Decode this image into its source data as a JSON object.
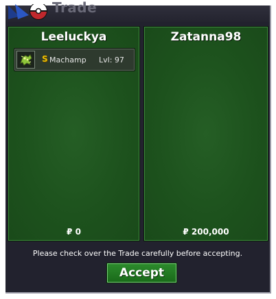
{
  "window": {
    "title": "Trade"
  },
  "left_panel": {
    "player_name": "Leeluckya",
    "items": [
      {
        "shiny_mark": "S",
        "pokemon": "Machamp",
        "level": "Lvl: 97",
        "icon": "machamp-sprite-icon"
      }
    ],
    "money": "₽ 0"
  },
  "right_panel": {
    "player_name": "Zatanna98",
    "items": [],
    "money": "₽ 200,000"
  },
  "footer": {
    "notice": "Please check over the Trade carefully before accepting.",
    "accept_label": "Accept"
  },
  "colors": {
    "panel_green": "#1d521d",
    "window_dark": "#22222e",
    "shiny_gold": "#f0c000",
    "button_green": "#2c8a2c"
  }
}
